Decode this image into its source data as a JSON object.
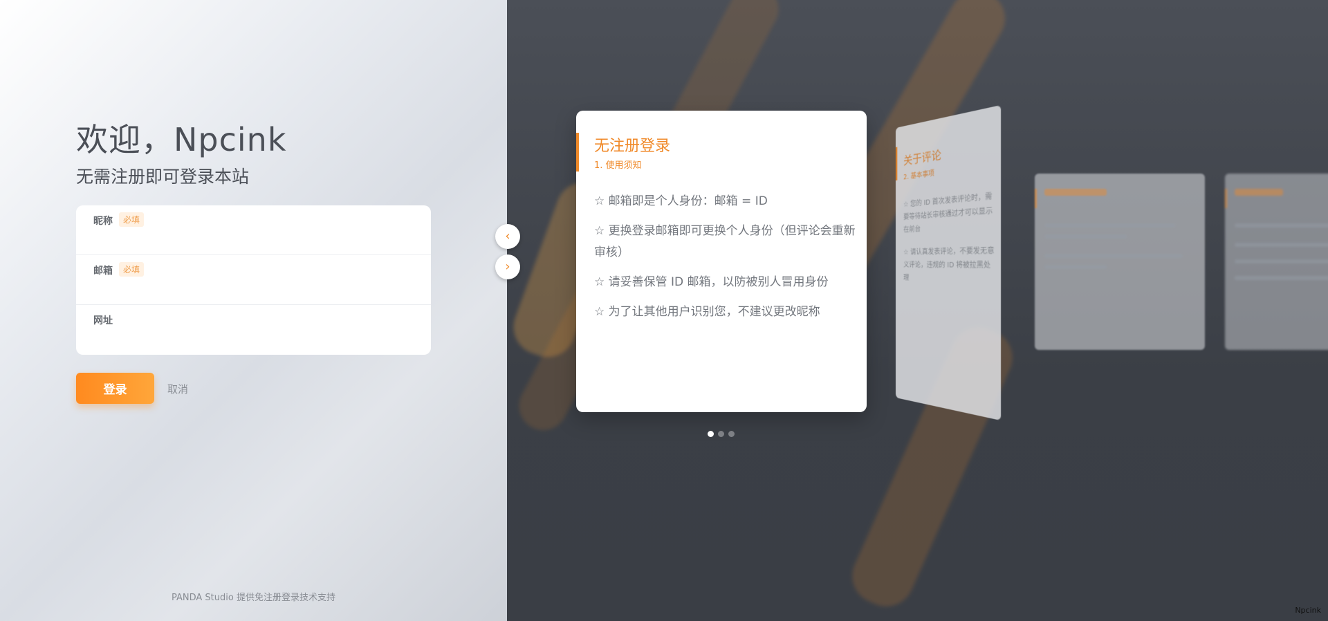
{
  "login": {
    "welcome": "欢迎，Npcink",
    "subtitle": "无需注册即可登录本站",
    "fields": [
      {
        "label": "昵称",
        "required_badge": "必填",
        "value": ""
      },
      {
        "label": "邮箱",
        "required_badge": "必填",
        "value": ""
      },
      {
        "label": "网址",
        "value": ""
      }
    ],
    "login_button": "登录",
    "cancel_button": "取消",
    "footer": "PANDA Studio 提供免注册登录技术支持"
  },
  "carousel": {
    "prev_icon": "‹",
    "next_icon": "›",
    "active_card": {
      "title": "无注册登录",
      "subtitle": "1. 使用须知",
      "items": [
        "☆ 邮箱即是个人身份：邮箱 = ID",
        "☆ 更换登录邮箱即可更换个人身份（但评论会重新审核）",
        "☆ 请妥善保管 ID 邮箱，以防被别人冒用身份",
        "☆ 为了让其他用户识别您，不建议更改昵称"
      ]
    },
    "next_card": {
      "title": "关于评论",
      "subtitle": "2. 基本事项",
      "items": [
        "☆ 您的 ID 首次发表评论时，需要等待站长审核通过才可以显示在前台",
        "☆ 请认真发表评论，不要发无意义评论，违规的 ID 将被拉黑处理"
      ]
    },
    "dots": 3,
    "active_dot": 0
  },
  "corner_label": "Npcink",
  "colors": {
    "accent": "#f08a2a",
    "button_start": "#ff8a1f",
    "button_end": "#ffa63a"
  }
}
